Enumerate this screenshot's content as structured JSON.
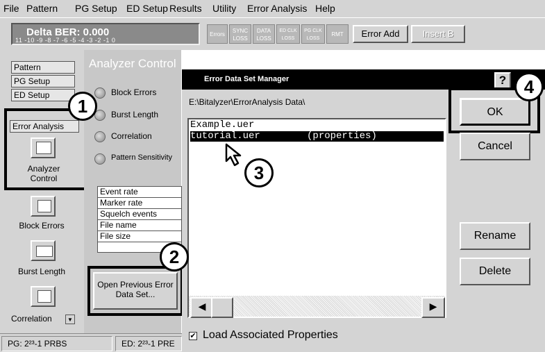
{
  "menu": [
    "File",
    "Pattern",
    "PG Setup",
    "ED Setup",
    "Results",
    "Utility",
    "Error Analysis",
    "Help"
  ],
  "toolbar": {
    "title": "Delta BER: 0.000",
    "scale": "11 -10 -9 -8 -7 -6 -5 -4 -3 -2 -1 0",
    "indicators": [
      "Errors",
      "SYNC LOSS",
      "DATA LOSS",
      "ED CLK LOSS",
      "PG CLK LOSS",
      "RMT"
    ],
    "error_add": "Error Add",
    "insert_b": "Insert B"
  },
  "nav": {
    "tabs": [
      "Pattern",
      "PG Setup",
      "ED Setup"
    ],
    "error_analysis": "Error Analysis",
    "analyzer_control": "Analyzer Control",
    "block_errors": "Block Errors",
    "burst_length": "Burst Length",
    "correlation": "Correlation"
  },
  "center": {
    "title": "Analyzer Control",
    "options": [
      "Block Errors",
      "Burst Length",
      "Correlation",
      "Pattern Sensitivity"
    ],
    "table_rows": [
      "Event rate",
      "Marker rate",
      "Squelch events",
      "File name",
      "File size"
    ],
    "open_button": "Open Previous Error Data Set..."
  },
  "status": {
    "pg": "PG: 2²³-1 PRBS",
    "ed": "ED: 2²³-1 PRE"
  },
  "dialog": {
    "title": "Error Data Set Manager",
    "help": "?",
    "path": "E:\\Bitalyzer\\ErrorAnalysis Data\\",
    "files": [
      "Example.uer",
      "tutorial.uer        (properties)"
    ],
    "ok": "OK",
    "cancel": "Cancel",
    "rename": "Rename",
    "delete": "Delete",
    "load_props": "Load Associated Properties",
    "load_props_checked": true
  },
  "callouts": [
    "1",
    "2",
    "3",
    "4"
  ]
}
